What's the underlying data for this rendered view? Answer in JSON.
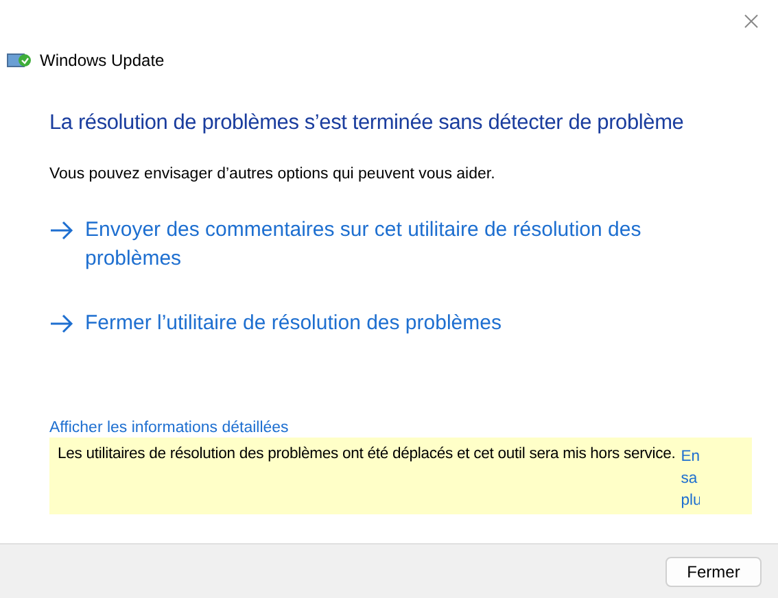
{
  "window": {
    "title": "Windows Update"
  },
  "heading": "La résolution de problèmes s’est terminée sans détecter de problème",
  "intro": "Vous pouvez envisager d’autres options qui peuvent vous aider.",
  "options": [
    {
      "label": "Envoyer des commentaires sur cet utilitaire de résolution des problèmes"
    },
    {
      "label": "Fermer l’utilitaire de résolution des problèmes"
    }
  ],
  "details_link": "Afficher les informations détaillées",
  "notice": {
    "text": "Les utilitaires de résolution des problèmes ont été déplacés et cet outil sera mis hors service.",
    "link_lines": [
      "En",
      "sa",
      "plu"
    ]
  },
  "buttons": [
    "Fermer"
  ]
}
